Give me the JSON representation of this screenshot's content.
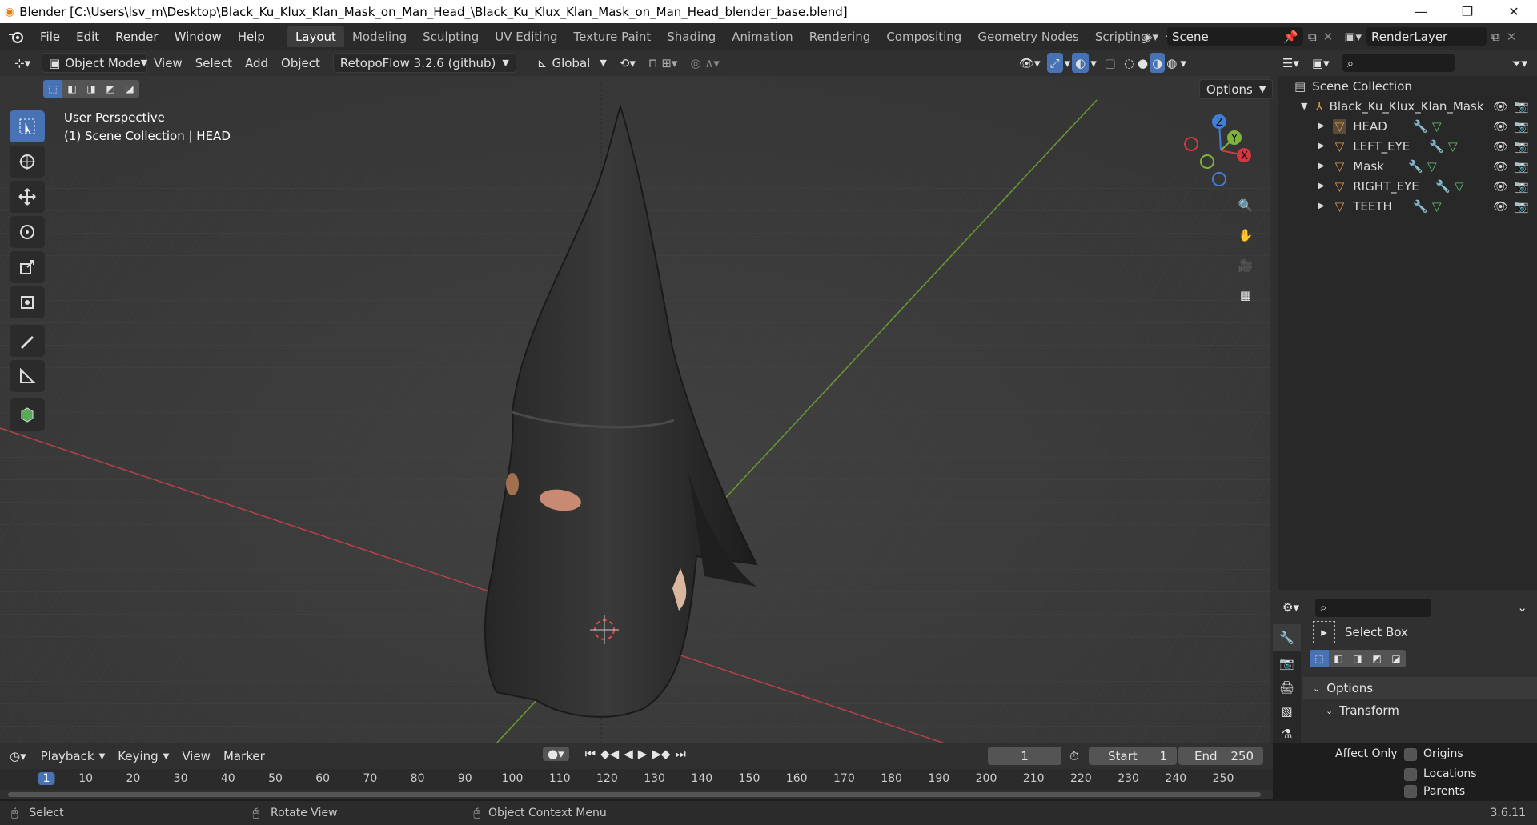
{
  "window": {
    "title": "Blender [C:\\Users\\lsv_m\\Desktop\\Black_Ku_Klux_Klan_Mask_on_Man_Head_\\Black_Ku_Klux_Klan_Mask_on_Man_Head_blender_base.blend]",
    "minimize": "—",
    "restore": "❐",
    "close": "✕"
  },
  "menus": [
    "File",
    "Edit",
    "Render",
    "Window",
    "Help"
  ],
  "workspace_tabs": [
    "Layout",
    "Modeling",
    "Sculpting",
    "UV Editing",
    "Texture Paint",
    "Shading",
    "Animation",
    "Rendering",
    "Compositing",
    "Geometry Nodes",
    "Scripting"
  ],
  "add_workspace": "+",
  "scene": {
    "name": "Scene",
    "render_layer": "RenderLayer"
  },
  "viewport_header": {
    "mode": "Object Mode",
    "menus": [
      "View",
      "Select",
      "Add",
      "Object"
    ],
    "addon": "RetopoFlow 3.2.6 (github)",
    "orientation": "Global",
    "options": "Options"
  },
  "overlay": {
    "perspective": "User Perspective",
    "collection": "(1) Scene Collection | HEAD"
  },
  "gizmo": {
    "z": "Z",
    "y": "Y",
    "x": "X"
  },
  "outliner": {
    "root": "Scene Collection",
    "collection": "Black_Ku_Klux_Klan_Mask",
    "objects": [
      "HEAD",
      "LEFT_EYE",
      "Mask",
      "RIGHT_EYE",
      "TEETH"
    ]
  },
  "properties": {
    "tool_name": "Select Box",
    "options_label": "Options",
    "transform_label": "Transform",
    "affect_only": "Affect Only",
    "checkboxes": [
      "Origins",
      "Locations",
      "Parents"
    ]
  },
  "timeline": {
    "menus": [
      "Playback",
      "Keying",
      "View",
      "Marker"
    ],
    "current_frame": "1",
    "start_label": "Start",
    "start_value": "1",
    "end_label": "End",
    "end_value": "250",
    "ruler": [
      "1",
      "10",
      "20",
      "30",
      "40",
      "50",
      "60",
      "70",
      "80",
      "90",
      "100",
      "110",
      "120",
      "130",
      "140",
      "150",
      "160",
      "170",
      "180",
      "190",
      "200",
      "210",
      "220",
      "230",
      "240",
      "250"
    ]
  },
  "status": {
    "select": "Select",
    "rotate": "Rotate View",
    "context": "Object Context Menu",
    "version": "3.6.11"
  },
  "colors": {
    "accent": "#4772b3",
    "x_axis": "#d2373f",
    "y_axis": "#80b33a",
    "z_axis": "#3f7fd9",
    "object_orange": "#e09a4d",
    "modifier_blue": "#6f8fe0",
    "mesh_green": "#58c46c"
  }
}
